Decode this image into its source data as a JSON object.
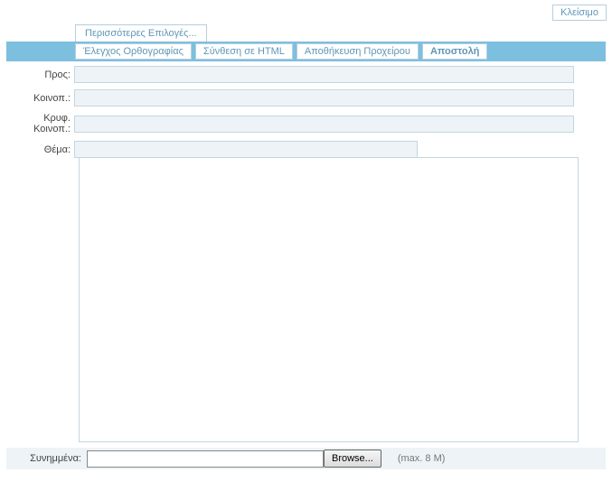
{
  "close_label": "Κλείσιμο",
  "more_options_label": "Περισσότερες Επιλογές...",
  "toolbar": {
    "spellcheck": "Έλεγχος Ορθογραφίας",
    "compose_html": "Σύνθεση σε HTML",
    "save_draft": "Αποθήκευση Προχείρου",
    "send": "Αποστολή"
  },
  "labels": {
    "to": "Προς:",
    "cc": "Κοινοπ.:",
    "bcc": "Κρυφ. Κοινοπ.:",
    "subject": "Θέμα:",
    "attachments": "Συνημμένα:"
  },
  "fields": {
    "to": "",
    "cc": "",
    "bcc": "",
    "subject": "",
    "body": "",
    "attachment_path": ""
  },
  "browse_label": "Browse...",
  "max_size_hint": "(max. 8 M)"
}
